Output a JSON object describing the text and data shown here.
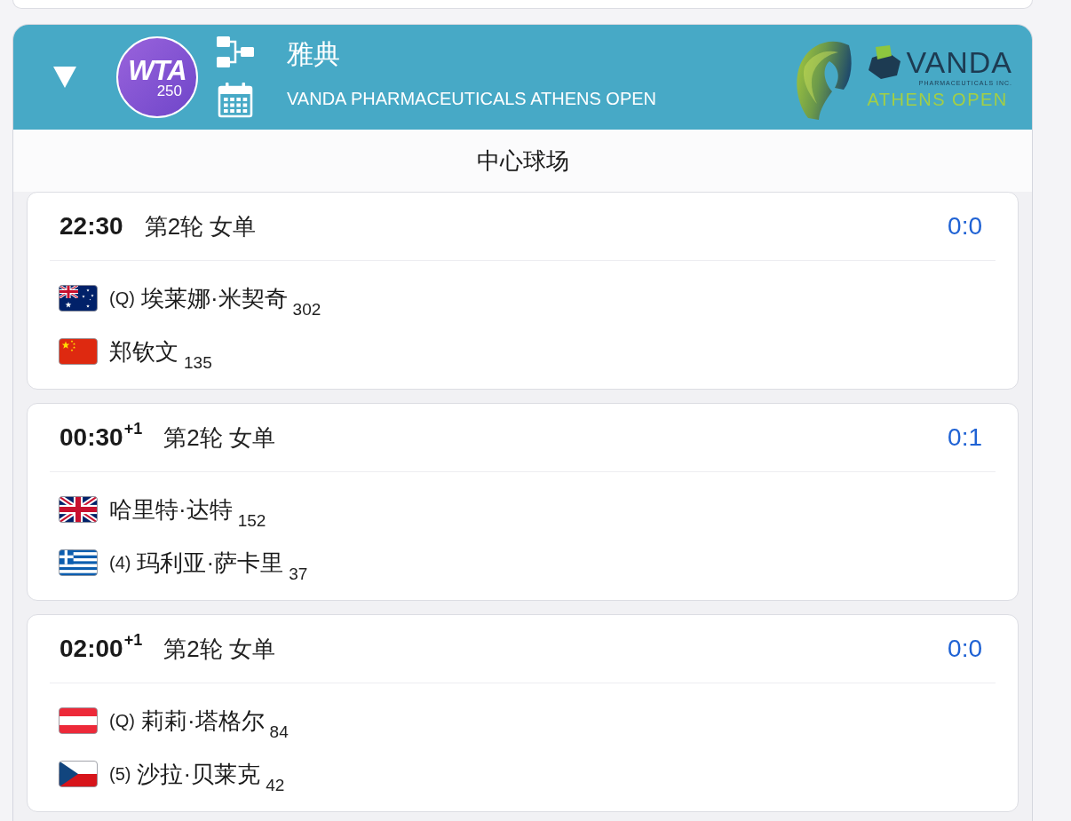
{
  "tournament": {
    "expanded": true,
    "tour_logo": {
      "text": "WTA",
      "level": "250"
    },
    "name": "雅典",
    "full_name": "VANDA PHARMACEUTICALS ATHENS OPEN",
    "sponsor_logo": {
      "name": "VANDA",
      "tagline": "PHARMACEUTICALS INC.",
      "event": "ATHENS OPEN"
    }
  },
  "court": {
    "name": "中心球场"
  },
  "matches": [
    {
      "time": "22:30",
      "round": "第2轮 女单",
      "score": "0:0",
      "players": [
        {
          "kind": "australia",
          "seed": "(Q)",
          "name": "埃莱娜·米契奇",
          "rank": "302"
        },
        {
          "kind": "china",
          "name": "郑钦文",
          "rank": "135"
        }
      ]
    },
    {
      "time": "00:30$^{+1}$",
      "round": "第2轮 女单",
      "score": "0:1",
      "players": [
        {
          "kind": "uk",
          "name": "哈里特·达特",
          "rank": "152"
        },
        {
          "kind": "greece",
          "seed": "(4)",
          "name": "玛利亚·萨卡里",
          "rank": "37"
        }
      ]
    },
    {
      "time": "02:00$^{+1}$",
      "round": "第2轮 女单",
      "score": "0:0",
      "players": [
        {
          "kind": "austria",
          "seed": "(Q)",
          "name": "莉莉·塔格尔",
          "rank": "84"
        },
        {
          "kind": "czech",
          "seed": "(5)",
          "name": "沙拉·贝莱克",
          "rank": "42"
        }
      ]
    }
  ]
}
